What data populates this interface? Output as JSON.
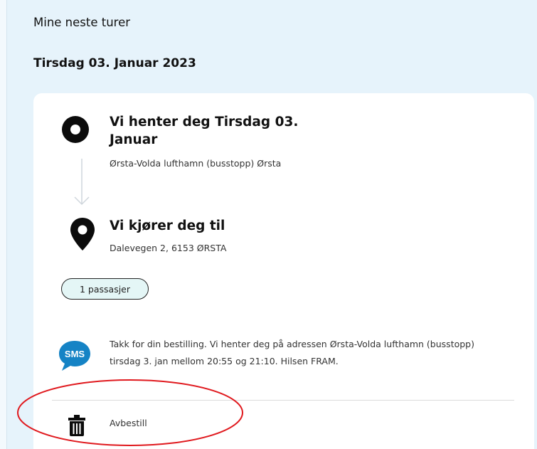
{
  "header": {
    "title": "Mine neste turer"
  },
  "trip": {
    "date": "Tirsdag 03. Januar 2023",
    "pickup": {
      "title": "Vi henter deg Tirsdag 03. Januar",
      "address": "Ørsta-Volda lufthamn (busstopp) Ørsta",
      "icon": "pickup-circle-icon"
    },
    "dropoff": {
      "title": "Vi kjører deg til",
      "address": "Dalevegen 2, 6153 ØRSTA",
      "icon": "map-pin-icon"
    },
    "passengers": "1 passasjer",
    "sms": {
      "icon_label": "SMS",
      "message": "Takk for din bestilling. Vi henter deg på adressen Ørsta-Volda lufthamn (busstopp) tirsdag 3. jan mellom 20:55 og 21:10. Hilsen FRAM."
    },
    "cancel_label": "Avbestill"
  },
  "colors": {
    "page_background": "#e6f3fb",
    "card_background": "#ffffff",
    "badge_background": "#e4f6f6",
    "sms_blue": "#1583c5",
    "annotation_red": "#e0191e"
  }
}
